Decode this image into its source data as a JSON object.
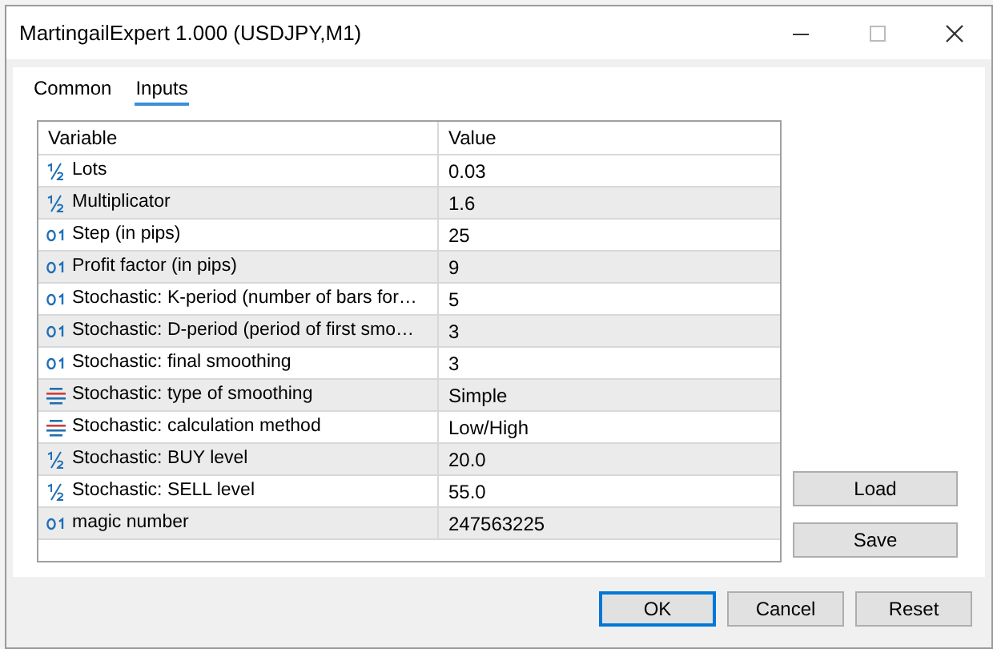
{
  "window": {
    "title": "MartingailExpert 1.000 (USDJPY,M1)"
  },
  "tabs": [
    {
      "label": "Common",
      "selected": false
    },
    {
      "label": "Inputs",
      "selected": true
    }
  ],
  "table": {
    "columns": [
      "Variable",
      "Value"
    ],
    "rows": [
      {
        "kind": "double",
        "variable": "Lots",
        "value": "0.03"
      },
      {
        "kind": "double",
        "variable": "Multiplicator",
        "value": "1.6"
      },
      {
        "kind": "int",
        "variable": "Step (in pips)",
        "value": "25"
      },
      {
        "kind": "int",
        "variable": "Profit factor (in pips)",
        "value": "9"
      },
      {
        "kind": "int",
        "variable": "Stochastic: K-period (number of bars for…",
        "value": "5"
      },
      {
        "kind": "int",
        "variable": "Stochastic: D-period (period of first smo…",
        "value": "3"
      },
      {
        "kind": "int",
        "variable": "Stochastic: final smoothing",
        "value": "3"
      },
      {
        "kind": "enum",
        "variable": "Stochastic: type of smoothing",
        "value": "Simple"
      },
      {
        "kind": "enum",
        "variable": "Stochastic: calculation method",
        "value": "Low/High"
      },
      {
        "kind": "double",
        "variable": "Stochastic: BUY level",
        "value": "20.0"
      },
      {
        "kind": "double",
        "variable": "Stochastic: SELL level",
        "value": "55.0"
      },
      {
        "kind": "int",
        "variable": "magic number",
        "value": "247563225"
      }
    ]
  },
  "side_buttons": [
    "Load",
    "Save"
  ],
  "buttons": [
    {
      "label": "OK",
      "default": true
    },
    {
      "label": "Cancel",
      "default": false
    },
    {
      "label": "Reset",
      "default": false
    }
  ]
}
